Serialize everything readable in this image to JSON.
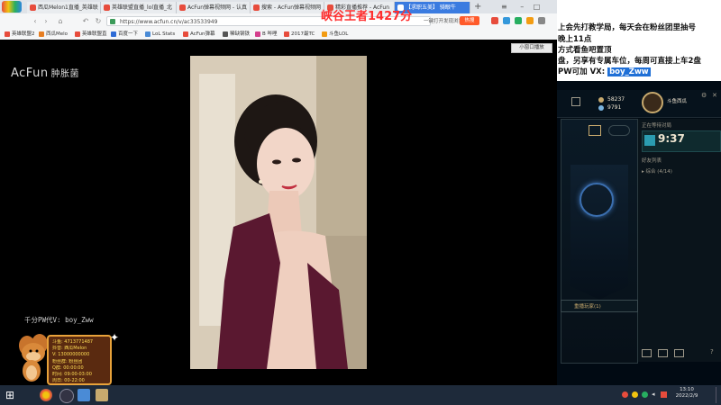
{
  "browser": {
    "tabs": [
      {
        "label": "西瓜Melon1直播_英雄联",
        "color": "#e74c3c"
      },
      {
        "label": "英雄联盟直播_lol直播_北",
        "color": "#e74c3c"
      },
      {
        "label": "AcFun弹幕视频网 - 认真",
        "color": "#e74c3c"
      },
      {
        "label": "搜索 - AcFun弹幕视频网",
        "color": "#e74c3c"
      },
      {
        "label": "精彩直播推荐 - AcFun",
        "color": "#e74c3c"
      },
      {
        "label": "【求职五美】 骑眼牛",
        "color": "#e74c3c"
      }
    ],
    "url": "https://www.acfun.cn/v/ac33533949",
    "toolbar_actions": [
      "一键打开发现浏览",
      "热搜"
    ],
    "bookmarks": [
      {
        "label": "英雄联盟2",
        "color": "#e74c3c"
      },
      {
        "label": "西瓜Melo",
        "color": "#e67e22"
      },
      {
        "label": "英雄联盟直",
        "color": "#e74c3c"
      },
      {
        "label": "百度一下",
        "color": "#2e6bd6"
      },
      {
        "label": "LoL Stats",
        "color": "#4a8bd6"
      },
      {
        "label": "AcFun弹幕",
        "color": "#e74c3c"
      },
      {
        "label": "稀缺钢铁",
        "color": "#555555"
      },
      {
        "label": "B 哔哩",
        "color": "#d43f8d"
      },
      {
        "label": "2017最TC",
        "color": "#e74c3c"
      },
      {
        "label": "斗鱼LOL",
        "color": "#f39c12"
      }
    ]
  },
  "player": {
    "logo_brand": "AcFun",
    "logo_sub": "肿胀菌",
    "float_button": "小窗口播放"
  },
  "overlay": {
    "title": "峡谷王者1427分",
    "pw_text": "千分PW代V: boy_Zww",
    "info_lines": [
      "斗鱼: 4713771487",
      "抖音: 西瓜Melon",
      "V: 13000000000",
      "粉丝群: 粉丝团",
      "Q群: 00:00:00",
      "时间: 09:00-03:00",
      "周日: 00-22:00"
    ]
  },
  "notice": {
    "line1": "上会先打教学局，每天会在粉丝团里抽号",
    "line2": "晚上11点",
    "line3": "方式看鱼吧置顶",
    "line4": "盘，另享有专属车位，每周可直接上车2盘",
    "line5_prefix": "PW可加 VX:",
    "vx_id": "boy_Zww"
  },
  "lol": {
    "points1": "58237",
    "points2": "9791",
    "clock": "9:37",
    "queue_label": "正在等待对局",
    "friends_header": "好友列表",
    "group_label": "▸ 综合 (4/14)",
    "rank_label": "英雄联盟",
    "streamer": "斗鱼西瓜",
    "bottom_label": "重播玩家(1)"
  },
  "taskbar": {
    "time": "13:10",
    "date": "2022/2/9"
  }
}
